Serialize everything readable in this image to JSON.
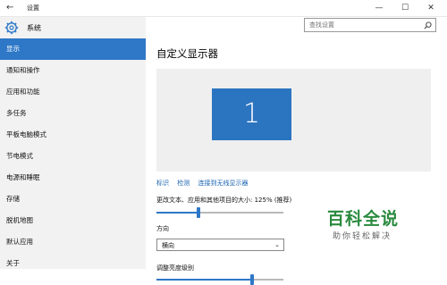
{
  "window": {
    "title": "设置",
    "back_glyph": "←",
    "controls": {
      "minimize": "—",
      "maximize": "☐",
      "close": "✕"
    }
  },
  "sidebar": {
    "header": {
      "icon": "gear-icon",
      "label": "系统"
    },
    "items": [
      {
        "label": "显示",
        "active": true
      },
      {
        "label": "通知和操作"
      },
      {
        "label": "应用和功能"
      },
      {
        "label": "多任务"
      },
      {
        "label": "平板电脑模式"
      },
      {
        "label": "节电模式"
      },
      {
        "label": "电源和睡眠"
      },
      {
        "label": "存储"
      },
      {
        "label": "脱机地图"
      },
      {
        "label": "默认应用"
      },
      {
        "label": "关于"
      }
    ]
  },
  "search": {
    "placeholder": "查找设置",
    "icon": "search-icon"
  },
  "main": {
    "title": "自定义显示器",
    "display_number": "1",
    "links": {
      "identify": "标识",
      "detect": "检测",
      "wireless": "连接到无线显示器"
    },
    "scale": {
      "label": "更改文本、应用和其他项目的大小: 125% (推荐)",
      "level": 0.33
    },
    "orientation": {
      "label": "方向",
      "value": "横向"
    },
    "brightness": {
      "label": "调整亮度级别",
      "level": 0.75
    }
  },
  "watermark": {
    "title": "百科全说",
    "subtitle": "助你轻松解决"
  },
  "colors": {
    "accent": "#2e78c7",
    "monitor": "#2b74c0",
    "sidebar_bg": "#f2f2f2",
    "link": "#1a63b0",
    "watermark": "#2a8a3e"
  }
}
